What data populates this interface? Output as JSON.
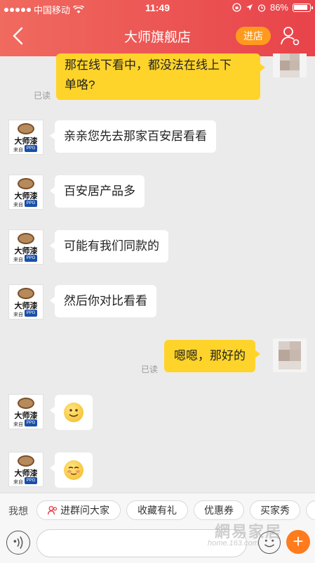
{
  "status_bar": {
    "carrier": "中国移动",
    "time": "11:49",
    "battery": "86%"
  },
  "header": {
    "title": "大师旗舰店",
    "shop_button": "进店"
  },
  "shop_avatar": {
    "logo_text": "大师漆",
    "sub_text": "来自",
    "brand_badge": "PPG"
  },
  "messages": [
    {
      "from": "me",
      "text_line1": "那在线下看中，都没法在线上下",
      "text_line2": "单咯?",
      "read": "已读"
    },
    {
      "from": "shop",
      "text": "亲亲您先去那家百安居看看"
    },
    {
      "from": "shop",
      "text": "百安居产品多"
    },
    {
      "from": "shop",
      "text": "可能有我们同款的"
    },
    {
      "from": "shop",
      "text": "然后你对比看看"
    },
    {
      "from": "me",
      "text": "嗯嗯，那好的",
      "read": "已读"
    },
    {
      "from": "shop",
      "emoji": "smile-emoji"
    },
    {
      "from": "shop",
      "emoji": "shy-emoji"
    }
  ],
  "quick_bar": {
    "label": "我想",
    "chips": [
      "进群问大家",
      "收藏有礼",
      "优惠券",
      "买家秀"
    ]
  },
  "input_bar": {
    "placeholder": ""
  },
  "watermark": {
    "main": "網易家居",
    "sub": "home.163.com"
  },
  "colors": {
    "header_start": "#f06a5f",
    "header_end": "#e8434a",
    "my_bubble": "#ffd42a",
    "accent_orange": "#ff7b1c"
  }
}
